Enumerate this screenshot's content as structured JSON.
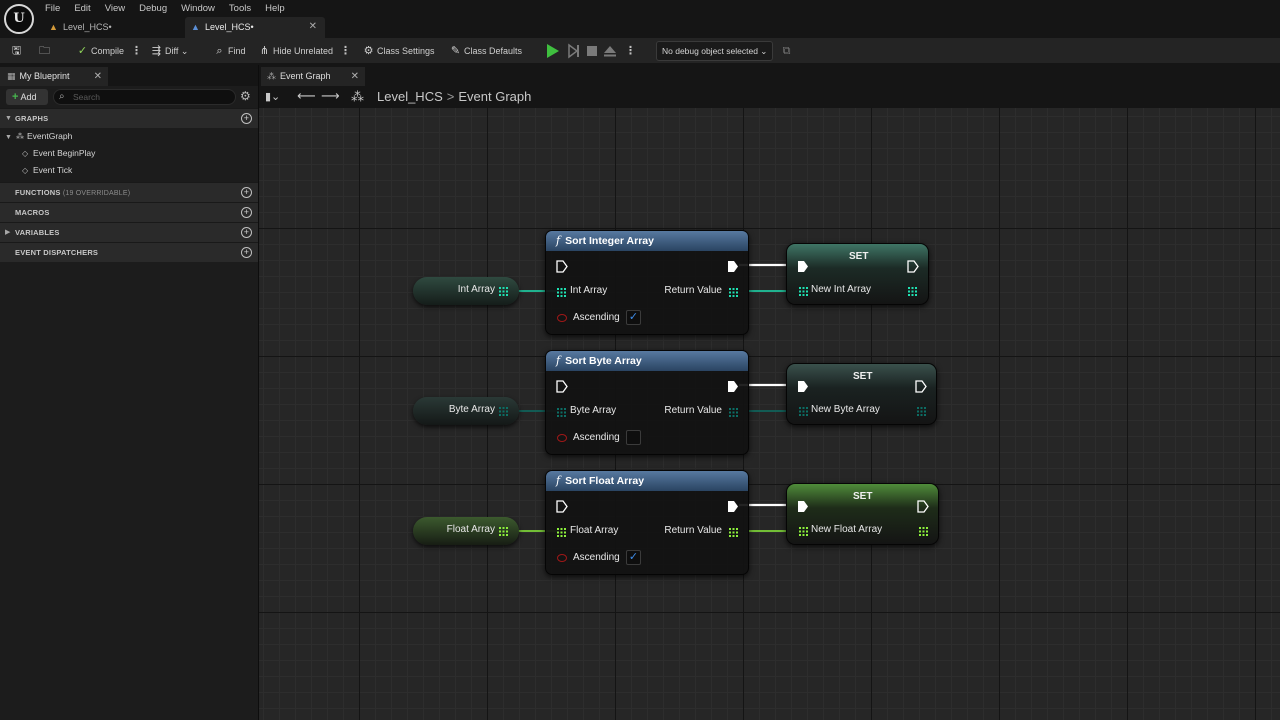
{
  "app": {
    "logo": "U",
    "menu": [
      "File",
      "Edit",
      "View",
      "Debug",
      "Window",
      "Tools",
      "Help"
    ],
    "doc_tabs": [
      {
        "label": "Level_HCS•",
        "active": false
      },
      {
        "label": "Level_HCS•",
        "active": true
      }
    ]
  },
  "toolbar": {
    "compile": "Compile",
    "diff": "Diff",
    "find": "Find",
    "hide_unrelated": "Hide Unrelated",
    "class_settings": "Class Settings",
    "class_defaults": "Class Defaults",
    "debug_object": "No debug object selected"
  },
  "left_panel": {
    "tab": "My Blueprint",
    "add": "Add",
    "search_placeholder": "Search",
    "sections": {
      "graphs": "GRAPHS",
      "functions": "FUNCTIONS",
      "functions_sub": "(19 OVERRIDABLE)",
      "macros": "MACROS",
      "variables": "VARIABLES",
      "dispatchers": "EVENT DISPATCHERS"
    },
    "tree": {
      "event_graph": "EventGraph",
      "begin_play": "Event BeginPlay",
      "tick": "Event Tick"
    }
  },
  "graph": {
    "tab": "Event Graph",
    "breadcrumb_level": "Level_HCS",
    "breadcrumb_sep": ">",
    "breadcrumb_graph": "Event Graph",
    "colors": {
      "int": "#1fe1b2",
      "byte": "#0c6d64",
      "float": "#8cf03c",
      "exec": "#ffffff",
      "bool": "#a01818"
    },
    "nodes": [
      {
        "title": "Sort Integer Array",
        "in_label": "Int Array",
        "out_label": "Return Value",
        "ascending_label": "Ascending",
        "ascending": true,
        "var_label": "Int Array",
        "set_title": "SET",
        "set_label": "New Int Array"
      },
      {
        "title": "Sort Byte Array",
        "in_label": "Byte Array",
        "out_label": "Return Value",
        "ascending_label": "Ascending",
        "ascending": false,
        "var_label": "Byte Array",
        "set_title": "SET",
        "set_label": "New Byte Array"
      },
      {
        "title": "Sort Float Array",
        "in_label": "Float Array",
        "out_label": "Return Value",
        "ascending_label": "Ascending",
        "ascending": true,
        "var_label": "Float Array",
        "set_title": "SET",
        "set_label": "New Float Array"
      }
    ]
  }
}
